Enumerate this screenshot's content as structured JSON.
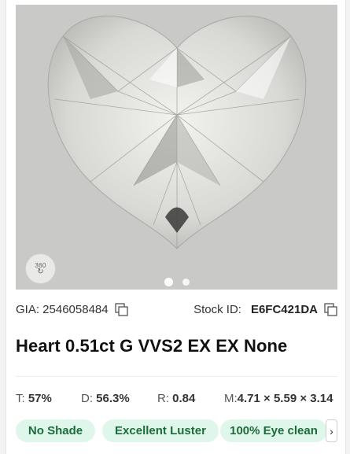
{
  "gallery": {
    "view360_label": "360",
    "view360_icon": "rotate-360-icon",
    "slide_count": 2,
    "active_slide": 1
  },
  "meta": {
    "gia_label": "GIA: 2546058484",
    "stock_label": "Stock ID:",
    "stock_value": "E6FC421DA",
    "copy_icon": "copy-icon"
  },
  "title": "Heart 0.51ct G VVS2 EX EX None",
  "specs": {
    "table_label": "T:",
    "table_value": "57%",
    "depth_label": "D:",
    "depth_value": "56.3%",
    "ratio_label": "R:",
    "ratio_value": "0.84",
    "measure_label": "M:",
    "measure_value": "4.71 × 5.59 × 3.14"
  },
  "chips": [
    "No Shade",
    "Excellent Luster",
    "100% Eye clean"
  ],
  "chips_next_icon": "chevron-right-icon",
  "colors": {
    "chip_bg": "#dff7ea",
    "chip_text": "#1d6b3a",
    "photo_bg": "#c9c9c7"
  }
}
